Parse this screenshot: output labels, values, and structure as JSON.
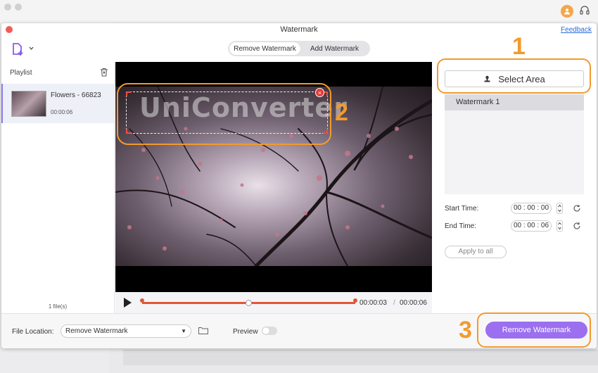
{
  "window": {
    "title": "Watermark",
    "feedback_link": "Feedback"
  },
  "mode_tabs": [
    {
      "label": "Remove Watermark",
      "active": true
    },
    {
      "label": "Add Watermark",
      "active": false
    }
  ],
  "playlist": {
    "title": "Playlist",
    "items": [
      {
        "name": "Flowers - 66823",
        "duration": "00:00:06"
      }
    ],
    "file_count": "1 file(s)"
  },
  "preview": {
    "watermark_text": "UniConverter",
    "current_time": "00:00:03",
    "separator": "/",
    "total_time": "00:00:06",
    "playback_position": 0.5
  },
  "right_panel": {
    "select_area_label": "Select Area",
    "watermarks": [
      "Watermark 1"
    ],
    "start_label": "Start Time:",
    "start_value": "00 : 00 : 00",
    "end_label": "End Time:",
    "end_value": "00 : 00 : 06",
    "apply_all_label": "Apply to all"
  },
  "bottom": {
    "file_location_label": "File Location:",
    "file_location_value": "Remove Watermark",
    "preview_label": "Preview",
    "preview_enabled": false,
    "remove_button_label": "Remove Watermark"
  },
  "annotations": {
    "step1": "1",
    "step2": "2",
    "step3": "3"
  },
  "colors": {
    "accent": "#9b6fef",
    "annotation": "#f39a2c",
    "timeline": "#e35537",
    "link": "#2a6ad8"
  }
}
